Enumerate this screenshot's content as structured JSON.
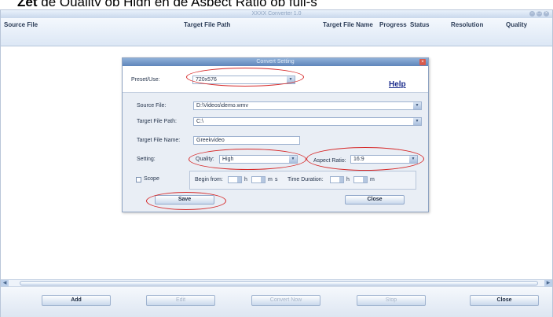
{
  "caption": {
    "prefix": "Zet",
    "text": "de Quality op High en de Aspect Ratio op full-s"
  },
  "window": {
    "title": "XXXX Converter 1.0",
    "min_glyph": "–",
    "max_glyph": "□",
    "close_glyph": "×"
  },
  "columns": {
    "source_file": "Source File",
    "target_file_path": "Target File Path",
    "target_file_name": "Target File Name",
    "progress": "Progress",
    "status": "Status",
    "resolution": "Resolution",
    "quality": "Quality"
  },
  "scrollbar": {
    "left_glyph": "◀",
    "right_glyph": "▶"
  },
  "bottom_buttons": {
    "add": "Add",
    "edit": "Edit",
    "convert_now": "Convert Now",
    "stop": "Stop",
    "close": "Close"
  },
  "dialog": {
    "title": "Convert Setting",
    "close_glyph": "×",
    "help": "Help",
    "preset_label": "Preset/Use:",
    "preset_value": "720x576",
    "source_file_label": "Source File:",
    "source_file_value": "D:\\Videos\\demo.wmv",
    "target_path_label": "Target File Path:",
    "target_path_value": "C:\\",
    "target_name_label": "Target File Name:",
    "target_name_value": "Greekvideo",
    "setting_label": "Setting:",
    "quality_label": "Quality:",
    "quality_value": "High",
    "aspect_label": "Aspect Ratio:",
    "aspect_value": "16:9",
    "scope_label": "Scope",
    "begin_label": "Begin from:",
    "unit_h": "h",
    "unit_m": "m",
    "unit_s": "s",
    "duration_label": "Time Duration:",
    "save_button": "Save",
    "close_button": "Close",
    "combo_arrow": "▼"
  }
}
